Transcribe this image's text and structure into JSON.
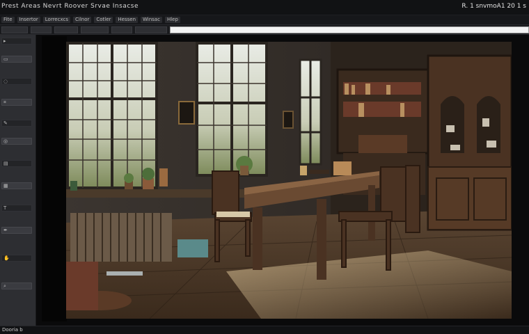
{
  "window": {
    "title": "Prest Areas Nevrt Roover Srvae Insacse",
    "right_info": "R. 1 snvmoA1 20 1 s"
  },
  "menubar": {
    "items": [
      "Fite",
      "Insertor",
      "Lorrecxcs",
      "Cilnor",
      "Cotler",
      "Hessen",
      "Winsac",
      "Hlep"
    ]
  },
  "options": {
    "field_value": ""
  },
  "tools": {
    "items": [
      {
        "name": "move-tool",
        "glyph": "▸"
      },
      {
        "name": "marquee-tool",
        "glyph": "▭"
      },
      {
        "name": "lasso-tool",
        "glyph": "◌"
      },
      {
        "name": "crop-tool",
        "glyph": "⌗"
      },
      {
        "name": "brush-tool",
        "glyph": "✎"
      },
      {
        "name": "clone-tool",
        "glyph": "◎"
      },
      {
        "name": "eraser-tool",
        "glyph": "▤"
      },
      {
        "name": "gradient-tool",
        "glyph": "▦"
      },
      {
        "name": "text-tool",
        "glyph": "T"
      },
      {
        "name": "pen-tool",
        "glyph": "✒"
      },
      {
        "name": "hand-tool",
        "glyph": "✋"
      },
      {
        "name": "zoom-tool",
        "glyph": "⌕"
      }
    ]
  },
  "status": {
    "text": "Dooria b"
  },
  "colors": {
    "chrome_dark": "#111214",
    "panel": "#2d2e32",
    "canvas_bg": "#0a0a0b"
  }
}
